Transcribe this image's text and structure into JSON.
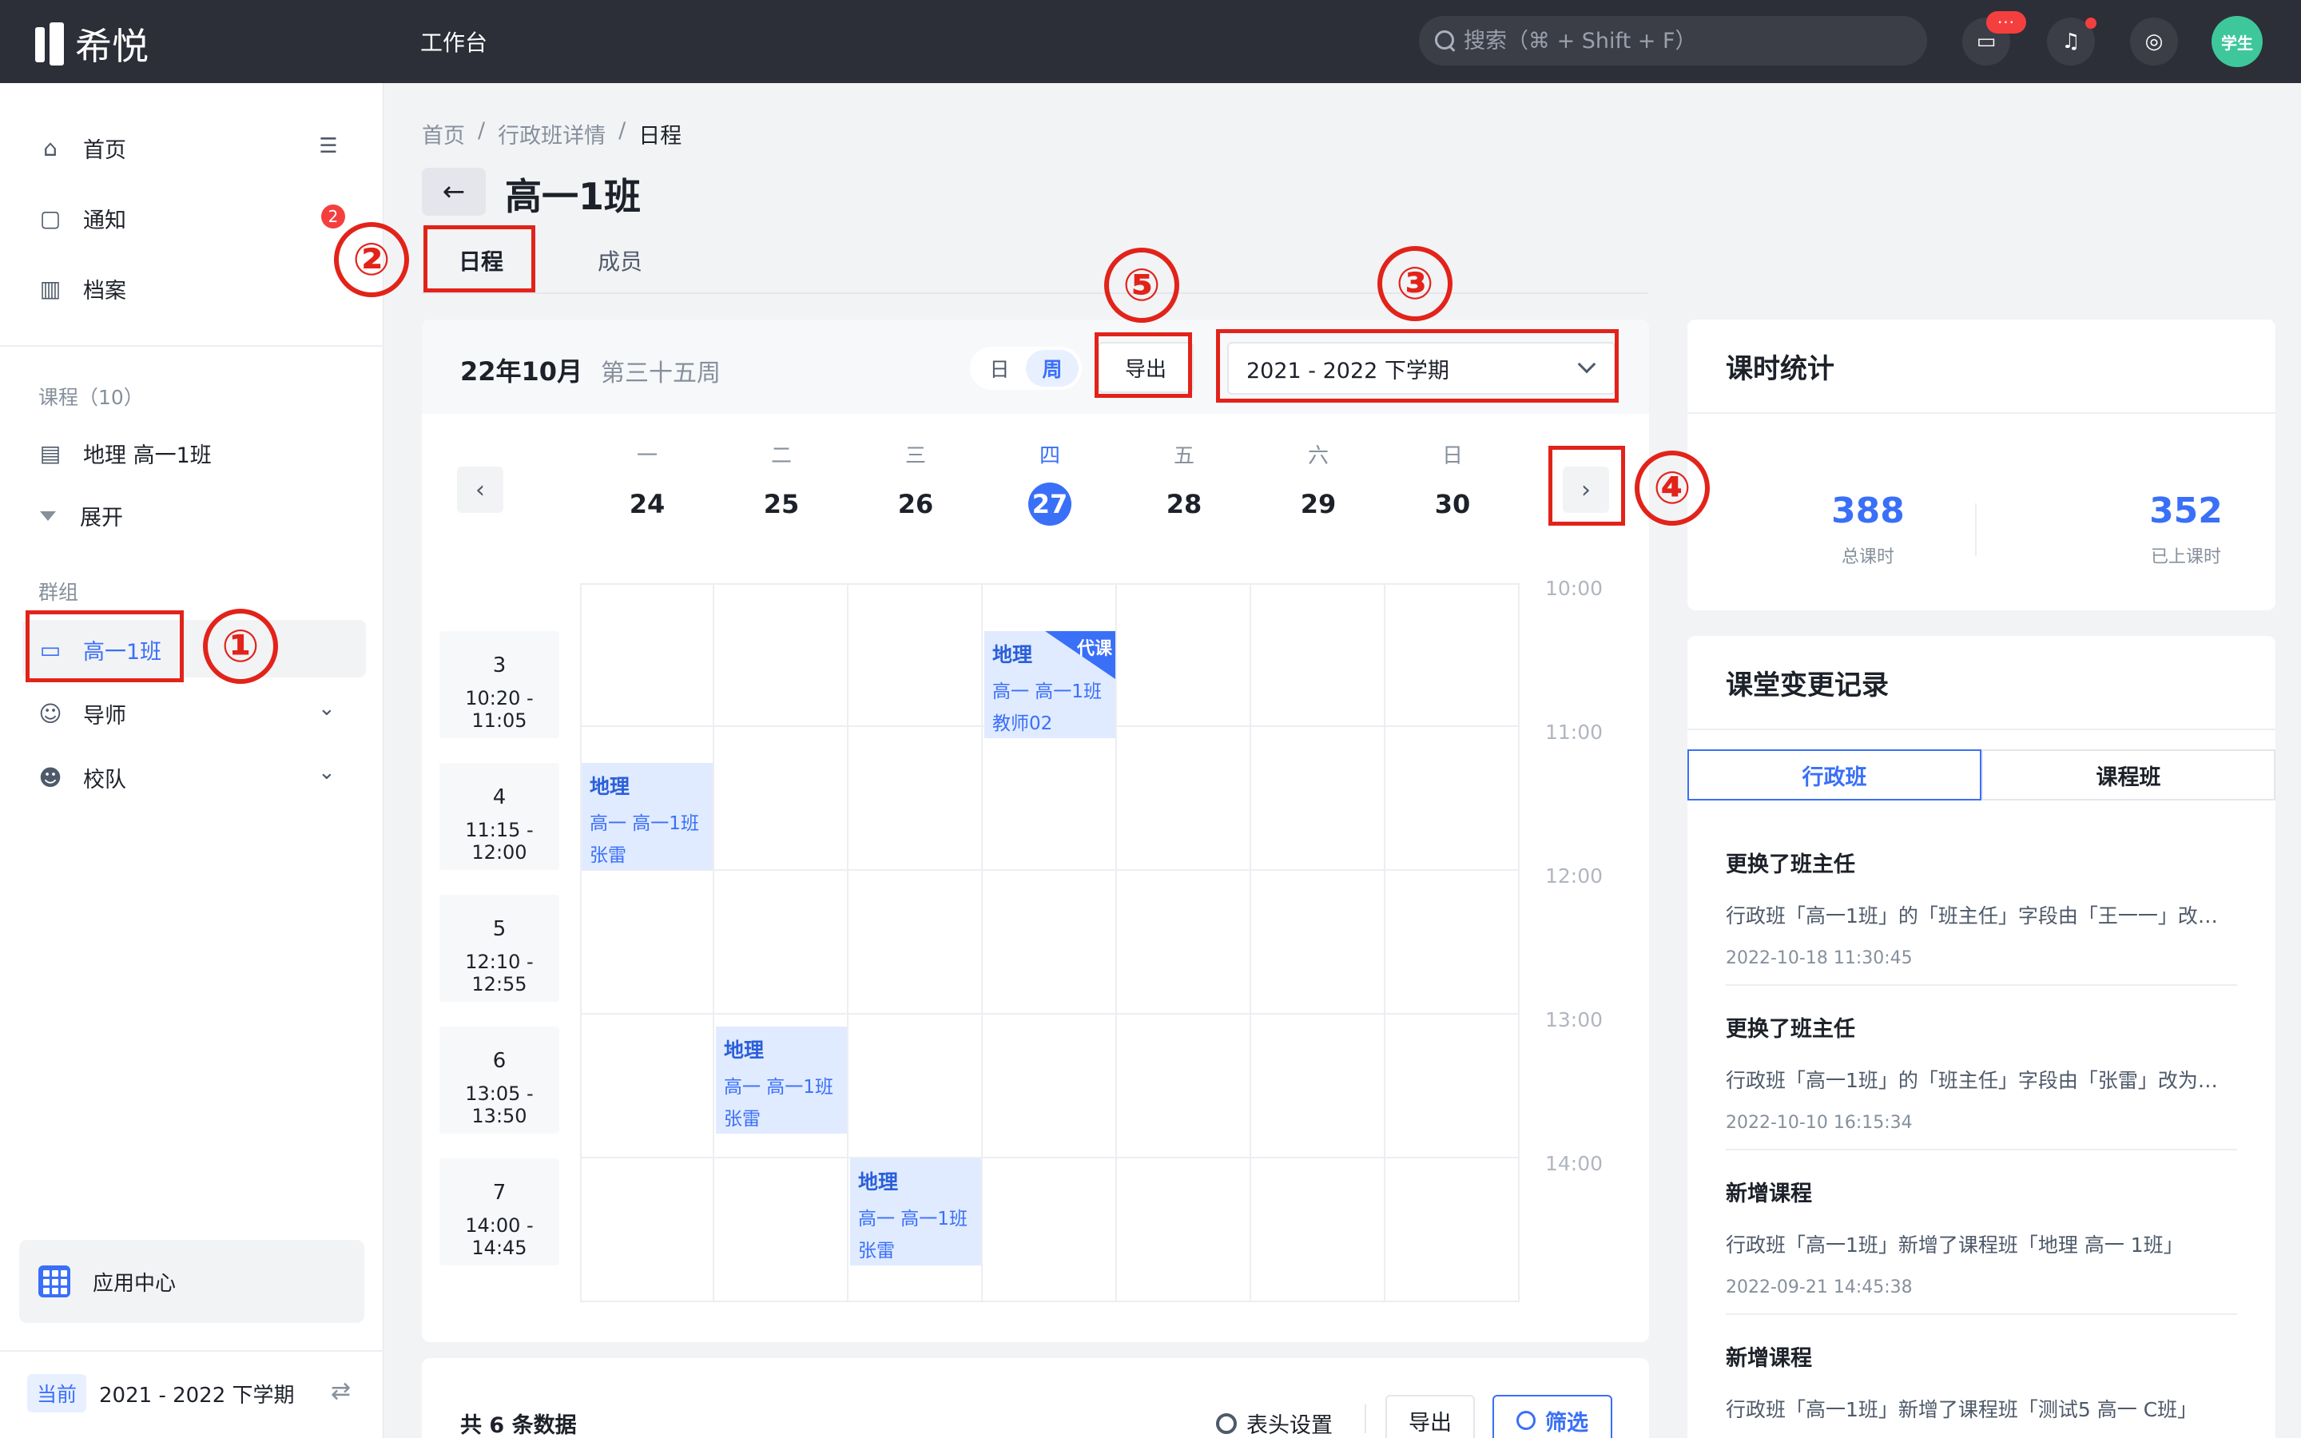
{
  "app": {
    "logo_text": "希悦",
    "title": "工作台",
    "search_placeholder": "搜索（⌘ + Shift + F）",
    "msg_badge": "···",
    "avatar_label": "学生"
  },
  "sidebar": {
    "nav": [
      {
        "label": "首页",
        "icon": "home-icon"
      },
      {
        "label": "通知",
        "icon": "message-icon",
        "badge": "2"
      },
      {
        "label": "档案",
        "icon": "archive-icon"
      }
    ],
    "course_section": "课程（10）",
    "course_item": "地理 高一1班",
    "expand_label": "展开",
    "group_section": "群组",
    "group_active": "高一1班",
    "group_items": [
      "导师",
      "校队"
    ],
    "app_center": "应用中心",
    "current_tag": "当前",
    "current_term": "2021 - 2022 下学期"
  },
  "header": {
    "breadcrumb": [
      "首页",
      "/",
      "行政班详情",
      "/",
      "日程"
    ],
    "title": "高一1班",
    "tabs": [
      "日程",
      "成员"
    ]
  },
  "calendar": {
    "month": "22年10月",
    "week": "第三十五周",
    "mode_day": "日",
    "mode_week": "周",
    "export_label": "导出",
    "term": "2021 - 2022 下学期",
    "days": [
      {
        "wd": "一",
        "date": "24"
      },
      {
        "wd": "二",
        "date": "25"
      },
      {
        "wd": "三",
        "date": "26"
      },
      {
        "wd": "四",
        "date": "27",
        "today": true
      },
      {
        "wd": "五",
        "date": "28"
      },
      {
        "wd": "六",
        "date": "29"
      },
      {
        "wd": "日",
        "date": "30"
      }
    ],
    "time_labels": [
      "10:00",
      "11:00",
      "12:00",
      "13:00",
      "14:00"
    ],
    "periods": [
      {
        "no": "3",
        "time": "10:20 - 11:05"
      },
      {
        "no": "4",
        "time": "11:15 - 12:00"
      },
      {
        "no": "5",
        "time": "12:10 - 12:55"
      },
      {
        "no": "6",
        "time": "13:05 - 13:50"
      },
      {
        "no": "7",
        "time": "14:00 - 14:45"
      }
    ],
    "events": [
      {
        "title": "地理",
        "class": "高一  高一1班",
        "teacher": "教师02",
        "tag": "代课",
        "day": 4,
        "period": "3"
      },
      {
        "title": "地理",
        "class": "高一  高一1班",
        "teacher": "张雷",
        "day": 1,
        "period": "4"
      },
      {
        "title": "地理",
        "class": "高一  高一1班",
        "teacher": "张雷",
        "day": 2,
        "period": "6"
      },
      {
        "title": "地理",
        "class": "高一  高一1班",
        "teacher": "张雷",
        "day": 3,
        "period": "7"
      }
    ]
  },
  "list": {
    "total": "共 6 条数据",
    "header_settings": "表头设置",
    "export": "导出",
    "filter": "筛选"
  },
  "stats": {
    "title": "课时统计",
    "total_value": "388",
    "total_label": "总课时",
    "done_value": "352",
    "done_label": "已上课时"
  },
  "changes": {
    "title": "课堂变更记录",
    "seg": [
      "行政班",
      "课程班"
    ],
    "items": [
      {
        "title": "更换了班主任",
        "desc": "行政班「高一1班」的「班主任」字段由「王一一」改…",
        "time": "2022-10-18 11:30:45"
      },
      {
        "title": "更换了班主任",
        "desc": "行政班「高一1班」的「班主任」字段由「张雷」改为…",
        "time": "2022-10-10 16:15:34"
      },
      {
        "title": "新增课程",
        "desc": "行政班「高一1班」新增了课程班「地理 高一 1班」",
        "time": "2022-09-21 14:45:38"
      },
      {
        "title": "新增课程",
        "desc": "行政班「高一1班」新增了课程班「测试5 高一 C班」",
        "time": ""
      }
    ]
  },
  "annotations": [
    "①",
    "②",
    "③",
    "④",
    "⑤"
  ],
  "colors": {
    "accent": "#3a6ff8",
    "annotation": "#e2231a",
    "topbar": "#2c2f38"
  }
}
